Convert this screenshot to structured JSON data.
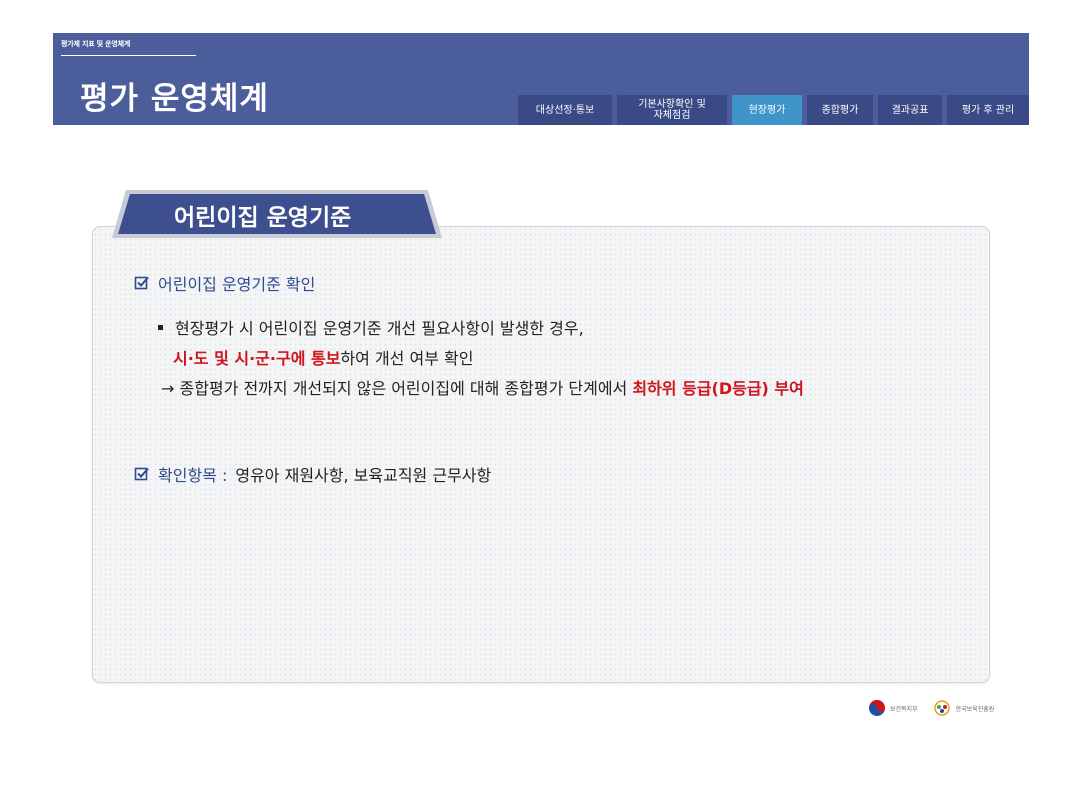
{
  "header": {
    "breadcrumb": "평가제 지표 및 운영체계",
    "title": "평가 운영체계",
    "tabs": [
      {
        "label": "대상선정·통보",
        "active": false
      },
      {
        "label": "기본사항확인 및\n자체점검",
        "active": false
      },
      {
        "label": "현장평가",
        "active": true
      },
      {
        "label": "종합평가",
        "active": false
      },
      {
        "label": "결과공표",
        "active": false
      },
      {
        "label": "평가 후 관리",
        "active": false
      }
    ],
    "colors": {
      "band": "#4c5d9c",
      "tab": "#3a4a86",
      "active_tab": "#3f95c9"
    }
  },
  "section": {
    "title": "어린이집 운영기준"
  },
  "content": {
    "check1": "어린이집 운영기준 확인",
    "bullet_line1": "현장평가 시 어린이집 운영기준 개선 필요사항이 발생한 경우,",
    "bullet_line2_red": "시·도 및 시·군·구에 통보",
    "bullet_line2_rest": "하여 개선 여부 확인",
    "arrow_line_prefix": "→ 종합평가 전까지 개선되지 않은 어린이집에 대해 종합평가 단계에서 ",
    "arrow_line_red": "최하위 등급(D등급) 부여",
    "check2_label": "확인항목 :",
    "check2_value": "영유아 재원사항, 보육교직원 근무사항"
  },
  "footer": {
    "logo1_text": "보건복지부",
    "logo2_text": "한국보육진흥원"
  }
}
